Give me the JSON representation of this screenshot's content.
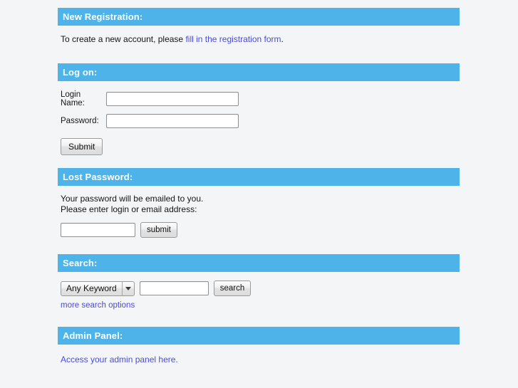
{
  "sections": [
    {
      "id": "new-registration",
      "title": "New Registration:",
      "intro_prefix": "To create a new account, please ",
      "intro_link": "fill in the registration form",
      "intro_suffix": "."
    },
    {
      "id": "log-on",
      "title": "Log on:",
      "login_label": "Login Name:",
      "login_value": "",
      "login_placeholder": "",
      "password_label": "Password:",
      "password_value": "",
      "password_placeholder": "",
      "submit_label": "Submit"
    },
    {
      "id": "lost-password",
      "title": "Lost Password:",
      "line1": "Your password will be emailed to you.",
      "line2": "Please enter login or email address:",
      "input_value": "",
      "input_placeholder": "",
      "submit_label": "submit"
    },
    {
      "id": "search",
      "title": "Search:",
      "keyword_select_value": "Any Keyword",
      "keyword_select_options": [
        "Any Keyword"
      ],
      "search_input_value": "",
      "search_input_placeholder": "",
      "search_button_label": "search",
      "more_options_label": "more search options"
    },
    {
      "id": "admin-panel",
      "title": "Admin Panel:",
      "admin_link_label": "Access your admin panel here."
    }
  ],
  "colors": {
    "header_blue": "#4db3e8",
    "link_blue": "#4a4ae0",
    "page_background": "#f4f5f7",
    "header_text": "#ffffff"
  },
  "icons": {
    "dropdown": "chevron-down-icon"
  }
}
